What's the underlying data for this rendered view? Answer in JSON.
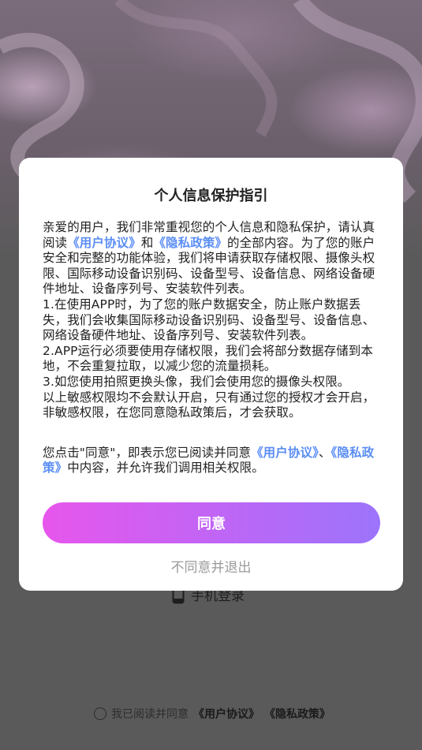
{
  "background": {
    "phone_login_label": "手机登录",
    "phone_icon": "mobile-phone-icon",
    "consent": {
      "prefix": "我已阅读并同意",
      "user_agreement": "《用户协议》",
      "privacy_policy": "《隐私政策》",
      "radio_icon": "radio-unchecked-icon"
    }
  },
  "modal": {
    "title": "个人信息保护指引",
    "intro": {
      "part1": "亲爱的用户，我们非常重视您的个人信息和隐私保护，请认真阅读",
      "user_agreement": "《用户协议》",
      "and": "和",
      "privacy_policy": "《隐私政策》",
      "part2": "的全部内容。为了您的账户安全和完整的功能体验，我们将申请获取存储权限、摄像头权限、国际移动设备识别码、设备型号、设备信息、网络设备硬件地址、设备序列号、安装软件列表。"
    },
    "items": [
      "1.在使用APP时，为了您的账户数据安全，防止账户数据丢失，我们会收集国际移动设备识别码、设备型号、设备信息、网络设备硬件地址、设备序列号、安装软件列表。",
      "2.APP运行必须要使用存储权限，我们会将部分数据存储到本地，不会重复拉取，以减少您的流量损耗。",
      "3.如您使用拍照更换头像，我们会使用您的摄像头权限。",
      "以上敏感权限均不会默认开启，只有通过您的授权才会开启，非敏感权限，在您同意隐私政策后，才会获取。"
    ],
    "confirm": {
      "part1": "您点击\"同意\"，即表示您已阅读并同意",
      "user_agreement": "《用户协议》",
      "sep": "、",
      "privacy_policy": "《隐私政策》",
      "part2": "中内容，并允许我们调用相关权限。"
    },
    "agree_label": "同意",
    "disagree_label": "不同意并退出"
  },
  "colors": {
    "link": "#5b8ef5",
    "button_gradient_start": "#e756ec",
    "button_gradient_end": "#9c74fb",
    "overlay_bg": "#5a5a5a"
  }
}
